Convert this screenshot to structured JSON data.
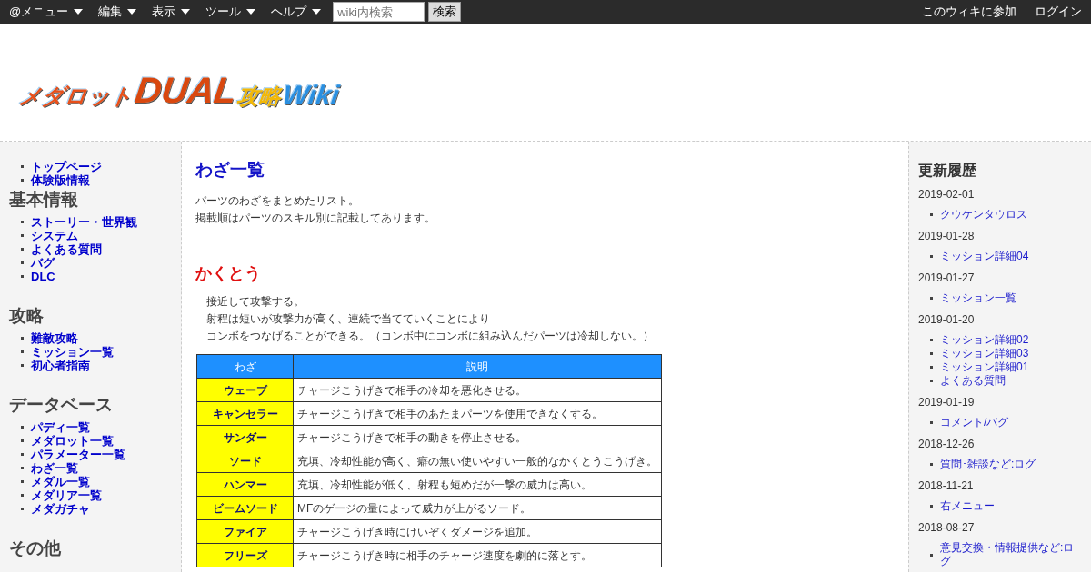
{
  "menubar": {
    "menus": [
      "@メニュー",
      "編集",
      "表示",
      "ツール",
      "ヘルプ"
    ],
    "search": {
      "placeholder": "wiki内検索",
      "button": "検索"
    },
    "links": [
      "このウィキに参加",
      "ログイン"
    ]
  },
  "logo": {
    "parts": [
      {
        "text": "メダロット",
        "color": "#e8501a"
      },
      {
        "text": "DUAL",
        "color": "#d9480f"
      },
      {
        "text": "攻略",
        "color": "#f2b807"
      },
      {
        "text": "Wiki",
        "color": "#2a8fe0"
      }
    ]
  },
  "left_menu": [
    {
      "items": [
        "トップページ",
        "体験版情報"
      ]
    },
    {
      "heading": "基本情報",
      "items": [
        "ストーリー・世界観",
        "システム",
        "よくある質問",
        "バグ",
        "DLC"
      ]
    },
    {
      "heading": "攻略",
      "items": [
        "難敵攻略",
        "ミッション一覧",
        "初心者指南"
      ]
    },
    {
      "heading": "データベース",
      "items": [
        "パディ一覧",
        "メダロット一覧",
        "パラメーター一覧",
        "わざ一覧",
        "メダル一覧",
        "メダリア一覧",
        "メダガチャ"
      ]
    },
    {
      "heading": "その他"
    }
  ],
  "article": {
    "title": "わざ一覧",
    "intro": [
      "パーツのわざをまとめたリスト。",
      "掲載順はパーツのスキル別に記載してあります。"
    ],
    "section": {
      "heading": "かくとう",
      "text": [
        "接近して攻撃する。",
        "射程は短いが攻撃力が高く、連続で当てていくことにより",
        "コンボをつなげることができる。（コンボ中にコンボに組み込んだパーツは冷却しない。）"
      ],
      "table": {
        "columns": [
          "わざ",
          "説明"
        ],
        "rows": [
          [
            "ウェーブ",
            "チャージこうげきで相手の冷却を悪化させる。"
          ],
          [
            "キャンセラー",
            "チャージこうげきで相手のあたまパーツを使用できなくする。"
          ],
          [
            "サンダー",
            "チャージこうげきで相手の動きを停止させる。"
          ],
          [
            "ソード",
            "充填、冷却性能が高く、癖の無い使いやすい一般的なかくとうこうげき。"
          ],
          [
            "ハンマー",
            "充填、冷却性能が低く、射程も短めだが一撃の威力は高い。"
          ],
          [
            "ビームソード",
            "MFのゲージの量によって威力が上がるソード。"
          ],
          [
            "ファイア",
            "チャージこうげき時にけいぞくダメージを追加。"
          ],
          [
            "フリーズ",
            "チャージこうげき時に相手のチャージ速度を劇的に落とす。"
          ]
        ]
      }
    }
  },
  "recent_updates": {
    "heading": "更新履歴",
    "days": [
      {
        "date": "2019-02-01",
        "items": [
          "クウケンタウロス"
        ]
      },
      {
        "date": "2019-01-28",
        "items": [
          "ミッション詳細04"
        ]
      },
      {
        "date": "2019-01-27",
        "items": [
          "ミッション一覧"
        ]
      },
      {
        "date": "2019-01-20",
        "items": [
          "ミッション詳細02",
          "ミッション詳細03",
          "ミッション詳細01",
          "よくある質問"
        ]
      },
      {
        "date": "2019-01-19",
        "items": [
          "コメント/バグ"
        ]
      },
      {
        "date": "2018-12-26",
        "items": [
          "質問･雑談など:ログ"
        ]
      },
      {
        "date": "2018-11-21",
        "items": [
          "右メニュー"
        ]
      },
      {
        "date": "2018-08-27",
        "items": [
          "意見交換・情報提供など:ログ"
        ]
      }
    ]
  }
}
